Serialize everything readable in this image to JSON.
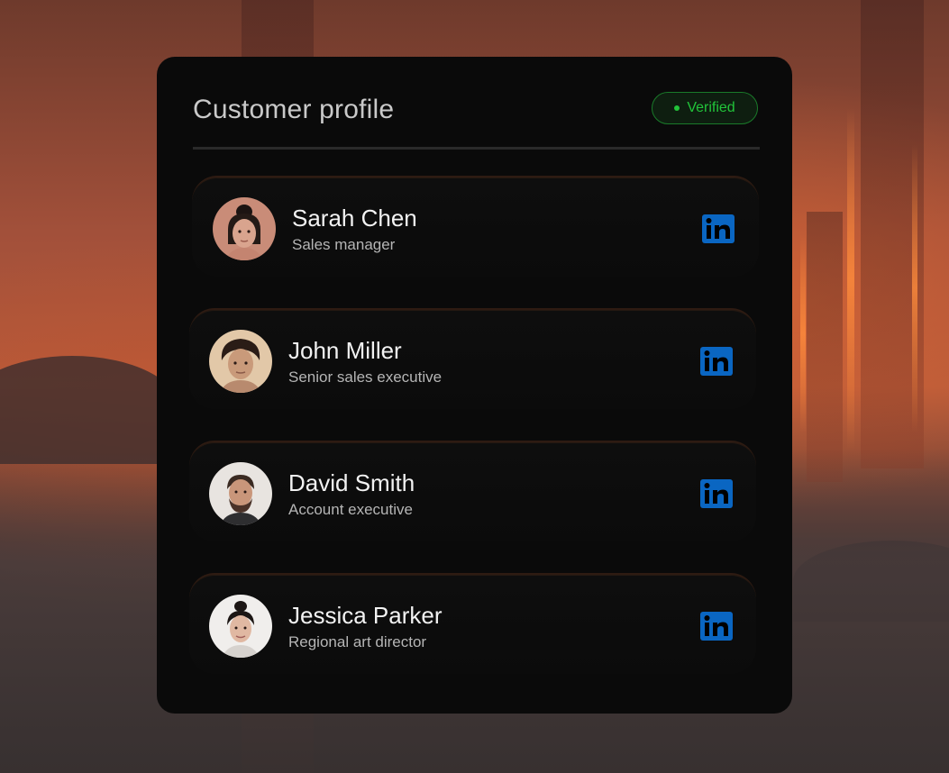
{
  "card": {
    "title": "Customer profile",
    "badge": "Verified"
  },
  "profiles": [
    {
      "name": "Sarah Chen",
      "role": "Sales manager",
      "avatar_icon": "avatar-photo",
      "link_icon": "linkedin-icon"
    },
    {
      "name": "John Miller",
      "role": "Senior sales executive",
      "avatar_icon": "avatar-photo",
      "link_icon": "linkedin-icon"
    },
    {
      "name": "David Smith",
      "role": "Account executive",
      "avatar_icon": "avatar-photo",
      "link_icon": "linkedin-icon"
    },
    {
      "name": "Jessica Parker",
      "role": "Regional art director",
      "avatar_icon": "avatar-photo",
      "link_icon": "linkedin-icon"
    }
  ],
  "colors": {
    "card_bg": "#0a0a0a",
    "badge_green": "#22c43a",
    "linkedin_blue": "#0a66c2",
    "accent_edge": "#2e1b12"
  }
}
